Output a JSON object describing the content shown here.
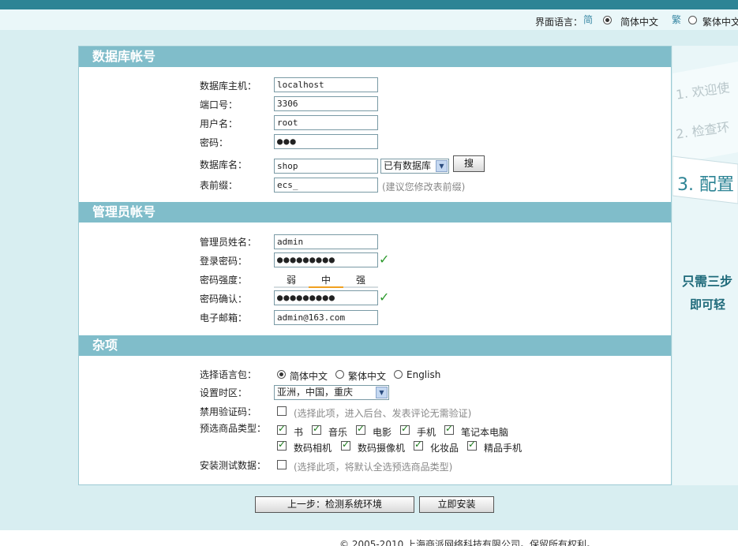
{
  "lang_bar": {
    "label": "界面语言：",
    "options": [
      {
        "label": "简体中文",
        "selected": true,
        "icon": "flag-simplified-icon"
      },
      {
        "label": "繁体中文",
        "selected": false,
        "icon": "flag-traditional-icon"
      }
    ]
  },
  "sections": {
    "db": "数据库帐号",
    "admin": "管理员帐号",
    "misc": "杂项"
  },
  "db": {
    "host_label": "数据库主机：",
    "host_value": "localhost",
    "port_label": "端口号：",
    "port_value": "3306",
    "user_label": "用户名：",
    "user_value": "root",
    "pass_label": "密码：",
    "pass_value": "●●●",
    "name_label": "数据库名：",
    "name_value": "shop",
    "existing_db": "已有数据库",
    "search_label": "搜",
    "prefix_label": "表前缀：",
    "prefix_value": "ecs_",
    "prefix_hint": "(建议您修改表前缀)"
  },
  "admin": {
    "name_label": "管理员姓名：",
    "name_value": "admin",
    "pass_label": "登录密码：",
    "pass_value": "●●●●●●●●●",
    "strength_label": "密码强度：",
    "strength": [
      "弱",
      "中",
      "强"
    ],
    "strength_level": "中",
    "confirm_label": "密码确认：",
    "confirm_value": "●●●●●●●●●",
    "email_label": "电子邮箱：",
    "email_value": "admin@163.com"
  },
  "misc": {
    "langpack_label": "选择语言包：",
    "langpacks": [
      {
        "label": "简体中文",
        "selected": true
      },
      {
        "label": "繁体中文",
        "selected": false
      },
      {
        "label": "English",
        "selected": false
      }
    ],
    "timezone_label": "设置时区：",
    "timezone_value": "亚洲，中国，重庆",
    "captcha_label": "禁用验证码：",
    "captcha_hint": "(选择此项，进入后台、发表评论无需验证)",
    "goods_label": "预选商品类型：",
    "goods": [
      {
        "label": "书",
        "checked": true
      },
      {
        "label": "音乐",
        "checked": true
      },
      {
        "label": "电影",
        "checked": true
      },
      {
        "label": "手机",
        "checked": true
      },
      {
        "label": "笔记本电脑",
        "checked": true
      },
      {
        "label": "数码相机",
        "checked": true
      },
      {
        "label": "数码摄像机",
        "checked": true
      },
      {
        "label": "化妆品",
        "checked": true
      },
      {
        "label": "精品手机",
        "checked": true
      }
    ],
    "testdata_label": "安装测试数据：",
    "testdata_hint": "(选择此项，将默认全选预选商品类型)"
  },
  "buttons": {
    "prev": "上一步：检测系统环境",
    "install": "立即安装"
  },
  "steps": {
    "step1": "1. 欢迎使",
    "step2": "2. 检查环",
    "step3": "3. 配置",
    "slogan1": "只需三步",
    "slogan2": "即可轻"
  },
  "footer": "© 2005-2010 上海商派网络科技有限公司。保留所有权利。"
}
